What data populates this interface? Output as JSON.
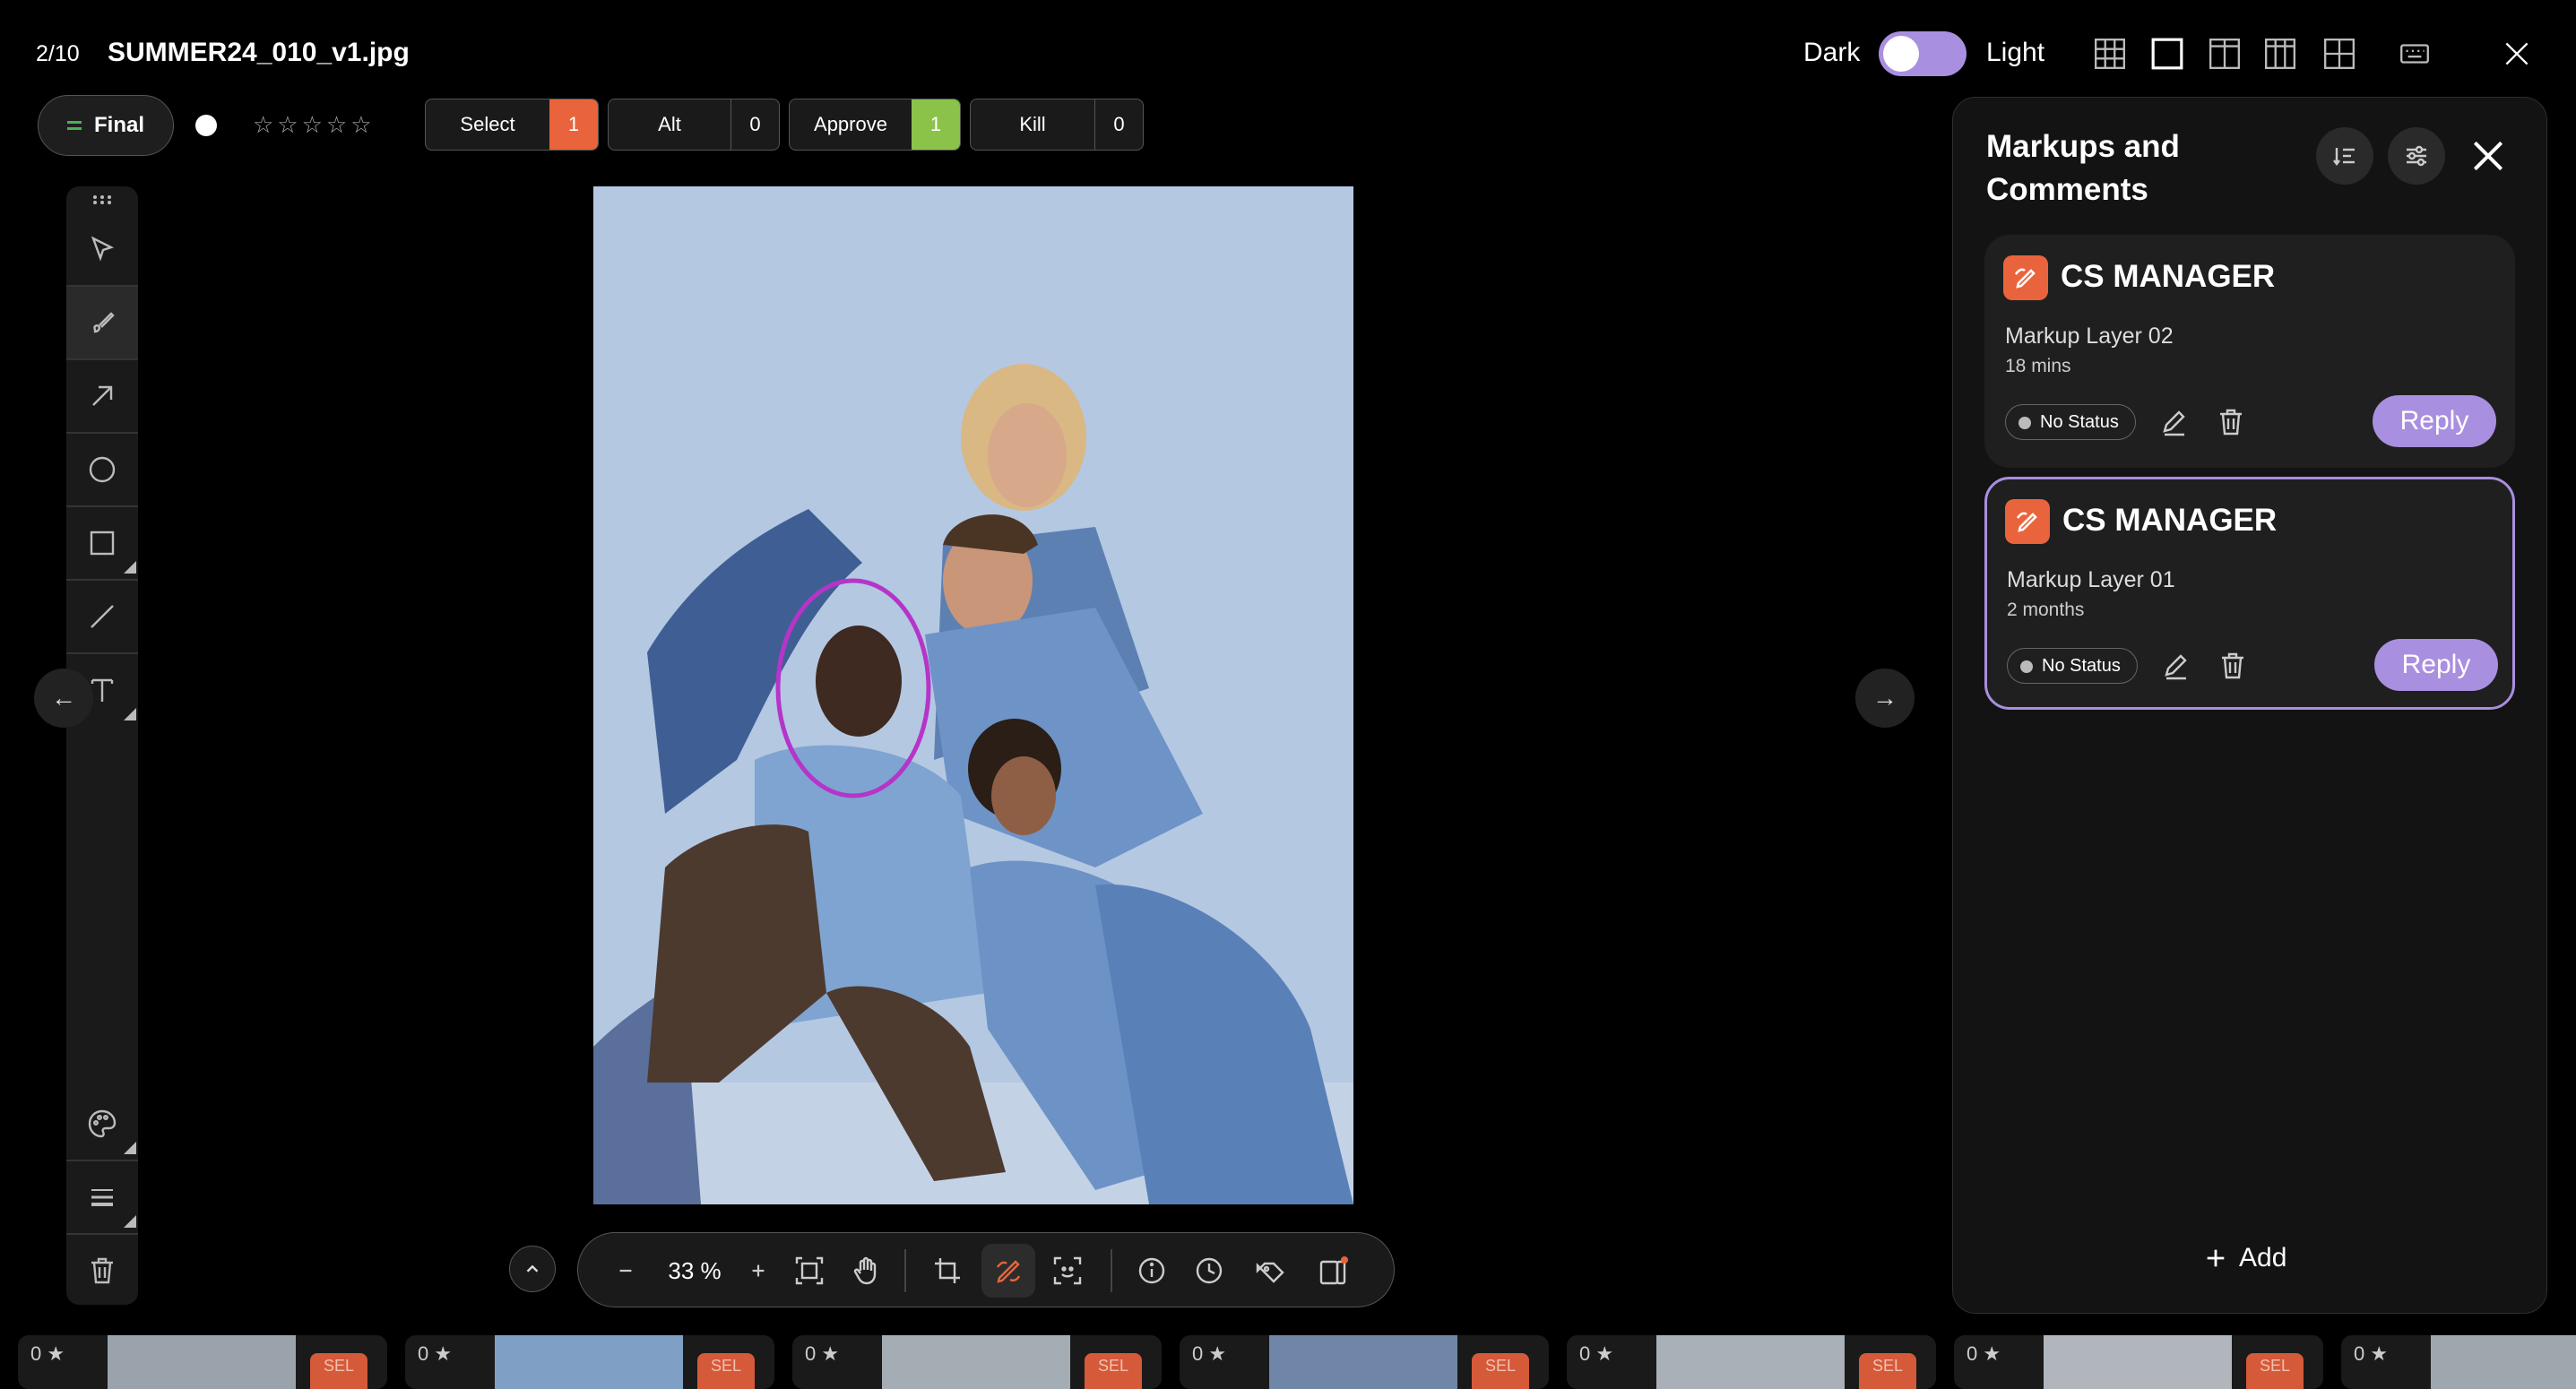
{
  "header": {
    "counter": "2/10",
    "filename": "SUMMER24_010_v1.jpg",
    "theme_dark": "Dark",
    "theme_light": "Light"
  },
  "review": {
    "final_label": "Final",
    "stars": "☆☆☆☆☆",
    "votes": [
      {
        "label": "Select",
        "count": "1",
        "color": "#e9643c"
      },
      {
        "label": "Alt",
        "count": "0",
        "color": "#1a1a1a"
      },
      {
        "label": "Approve",
        "count": "1",
        "color": "#8bc34a"
      },
      {
        "label": "Kill",
        "count": "0",
        "color": "#1a1a1a"
      }
    ]
  },
  "viewer": {
    "zoom": "33 %",
    "nav_prev": "←",
    "nav_next": "→"
  },
  "panel": {
    "title": "Markups and Comments",
    "add_label": "Add",
    "comments": [
      {
        "author": "CS MANAGER",
        "layer": "Markup Layer 02",
        "time": "18 mins",
        "status": "No Status",
        "reply": "Reply"
      },
      {
        "author": "CS MANAGER",
        "layer": "Markup Layer 01",
        "time": "2 months",
        "status": "No Status",
        "reply": "Reply"
      }
    ]
  },
  "filmstrip": [
    {
      "rating": "0 ★",
      "tag": "SEL"
    },
    {
      "rating": "0 ★",
      "tag": "SEL"
    },
    {
      "rating": "0 ★",
      "tag": "SEL"
    },
    {
      "rating": "0 ★",
      "tag": "SEL"
    },
    {
      "rating": "0 ★",
      "tag": "SEL"
    },
    {
      "rating": "0 ★",
      "tag": "SEL"
    },
    {
      "rating": "0 ★",
      "tag": ""
    }
  ],
  "colors": {
    "accent": "#a98fe0",
    "brand_orange": "#e9643c",
    "approve_green": "#8bc34a",
    "markup_ellipse": "#b535c8"
  }
}
